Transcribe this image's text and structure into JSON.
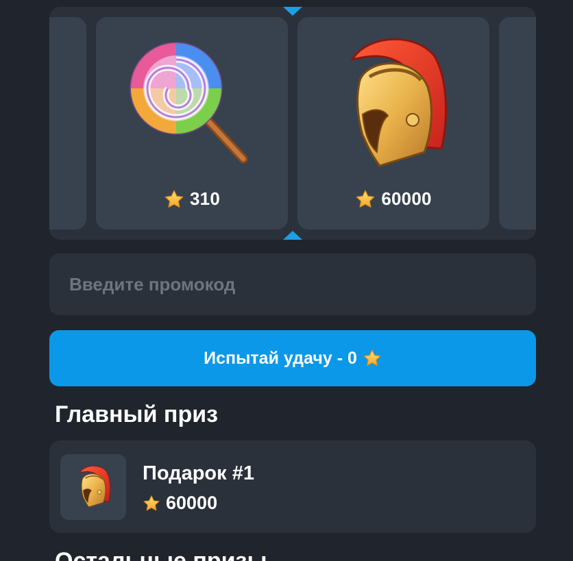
{
  "roulette": {
    "items": [
      {
        "name": "lollipop",
        "price": "310"
      },
      {
        "name": "spartan-helmet",
        "price": "60000"
      }
    ],
    "currency_icon": "star-icon",
    "marker_color": "#1a9fe8"
  },
  "promo": {
    "placeholder": "Введите промокод",
    "value": ""
  },
  "spin_button": {
    "label": "Испытай удачу - 0",
    "icon": "star-icon",
    "color": "#0b98e8"
  },
  "main_prize": {
    "heading": "Главный приз",
    "name": "Подарок #1",
    "price": "60000",
    "icon": "spartan-helmet-icon"
  },
  "other_prizes": {
    "heading": "Остальные призы"
  }
}
